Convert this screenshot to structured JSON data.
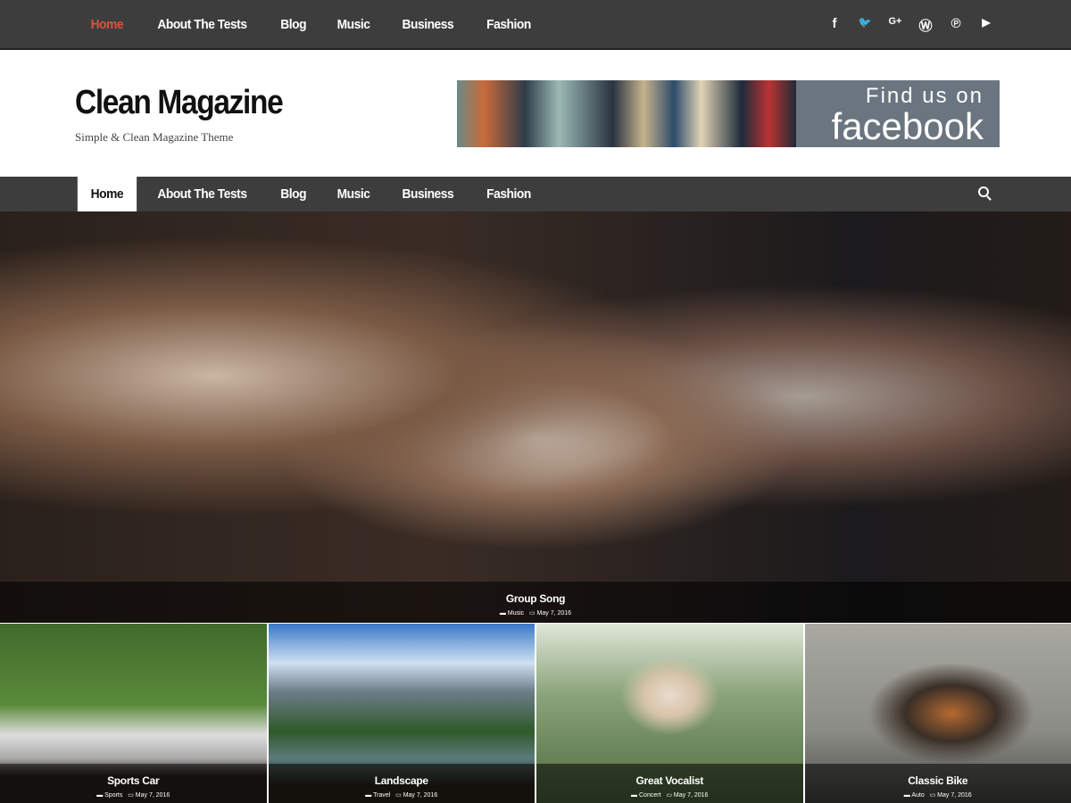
{
  "nav": [
    {
      "label": "Home"
    },
    {
      "label": "About The Tests"
    },
    {
      "label": "Blog"
    },
    {
      "label": "Music"
    },
    {
      "label": "Business"
    },
    {
      "label": "Fashion"
    }
  ],
  "social": [
    {
      "icon": "facebook-icon",
      "glyph": "f"
    },
    {
      "icon": "twitter-icon",
      "glyph": "🐦"
    },
    {
      "icon": "google-plus-icon",
      "glyph": "G+"
    },
    {
      "icon": "wordpress-icon",
      "glyph": "Ⓦ"
    },
    {
      "icon": "pinterest-icon",
      "glyph": "℗"
    },
    {
      "icon": "youtube-icon",
      "glyph": "▶"
    }
  ],
  "site": {
    "title": "Clean Magazine",
    "tagline": "Simple & Clean Magazine Theme"
  },
  "banner": {
    "line1": "Find us on",
    "line2": "facebook"
  },
  "colors": {
    "accent": "#e2513e",
    "bar": "#3d3d3d"
  },
  "hero": {
    "title": "Group Song",
    "category": "Music",
    "date": "May 7, 2016"
  },
  "tiles": [
    {
      "title": "Sports Car",
      "category": "Sports",
      "date": "May 7, 2016"
    },
    {
      "title": "Landscape",
      "category": "Travel",
      "date": "May 7, 2016"
    },
    {
      "title": "Great Vocalist",
      "category": "Concert",
      "date": "May 7, 2016"
    },
    {
      "title": "Classic Bike",
      "category": "Auto",
      "date": "May 7, 2016"
    }
  ]
}
